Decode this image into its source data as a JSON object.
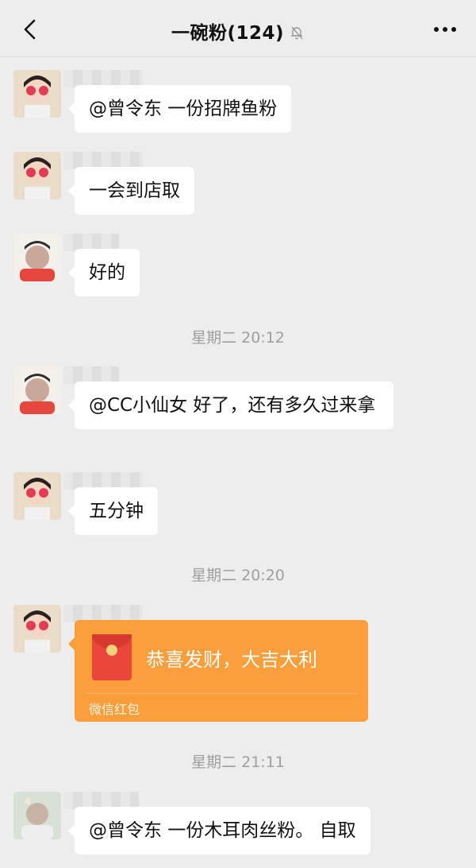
{
  "header": {
    "title": "一碗粉(124)",
    "back_icon": "chevron-left-icon",
    "mute_icon": "bell-off-icon",
    "more_icon": "more-horizontal-icon"
  },
  "messages": [
    {
      "text": "@曾令东 一份招牌鱼粉"
    },
    {
      "text": "一会到店取"
    },
    {
      "text": "好的"
    },
    {
      "time": "星期二 20:12"
    },
    {
      "text": "@CC小仙女 好了，还有多久过来拿"
    },
    {
      "text": "五分钟"
    },
    {
      "time": "星期二 20:20"
    },
    {
      "red_packet": {
        "greeting": "恭喜发财，大吉大利",
        "label": "微信红包"
      }
    },
    {
      "time": "星期二 21:11"
    },
    {
      "text": "@曾令东 一份木耳肉丝粉。 自取"
    }
  ],
  "colors": {
    "background": "#ededed",
    "bubble": "#ffffff",
    "red_packet": "#fa9d3b",
    "timestamp": "#9e9e9e"
  }
}
